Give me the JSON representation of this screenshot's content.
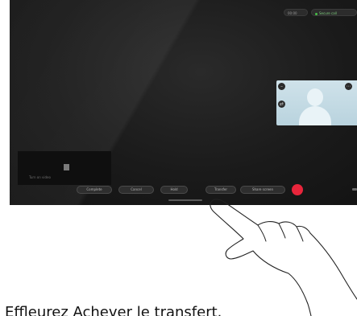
{
  "status": {
    "pill_1": "00:00",
    "pill_2": "Secure call"
  },
  "self_view": {
    "btn_1_icon": "minimize-icon",
    "btn_2_icon": "more-icon",
    "btn_3_icon": "swap-icon",
    "btn_1_glyph": "–",
    "btn_2_glyph": "⋯",
    "btn_3_glyph": "⇄"
  },
  "camera_tile": {
    "label": "Turn on video"
  },
  "controls": {
    "items": [
      {
        "label": "Complete"
      },
      {
        "label": "Cancel"
      },
      {
        "label": "Hold"
      },
      {
        "label": "Transfer"
      },
      {
        "label": "Share screen"
      }
    ],
    "end_call_color": "#e8253b"
  },
  "caption": "Effleurez Achever le transfert."
}
